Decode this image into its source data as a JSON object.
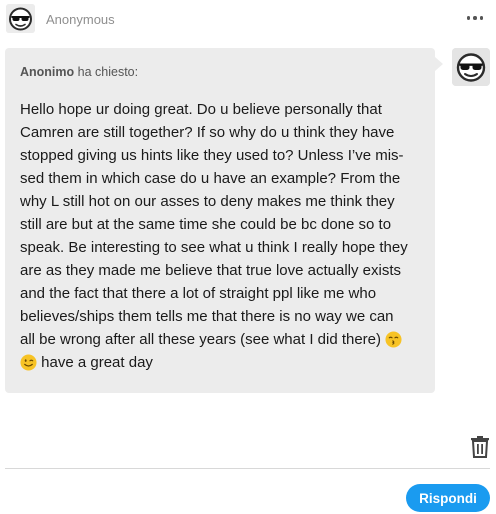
{
  "header": {
    "name": "Anonymous",
    "avatar_icon": "sunglasses-face-icon",
    "menu_icon": "more-horizontal-icon"
  },
  "question": {
    "asker_name": "Anonimo",
    "asked_label": "ha chiesto:",
    "lines": [
      "Hello hope ur doing great. Do u believe personally that",
      "Camren are still together? If so why do u think they have",
      "stopped giving us hints like they used to? Unless I’ve mis-",
      "sed them in which case do u have an example? From the",
      "why L still hot on our asses to deny makes me think they",
      "still are but at the same time she could be bc done so to",
      "speak. Be interesting to see what u think I really hope they",
      "are as they made me believe that true love actually exists",
      "and the fact that there a lot of straight ppl like me who",
      "believes/ships them tells me that there is no way we can",
      "all be wrong after all these years (see what I did there)"
    ],
    "last_line": "have a great day",
    "emoji_1": "kissing-face-emoji",
    "emoji_2": "winking-face-emoji"
  },
  "actions": {
    "delete_icon": "trash-icon",
    "reply_label": "Rispondi"
  },
  "colors": {
    "bubble_bg": "#ececec",
    "reply_button": "#1a9bf0",
    "secondary_text": "#8f8f8f"
  }
}
